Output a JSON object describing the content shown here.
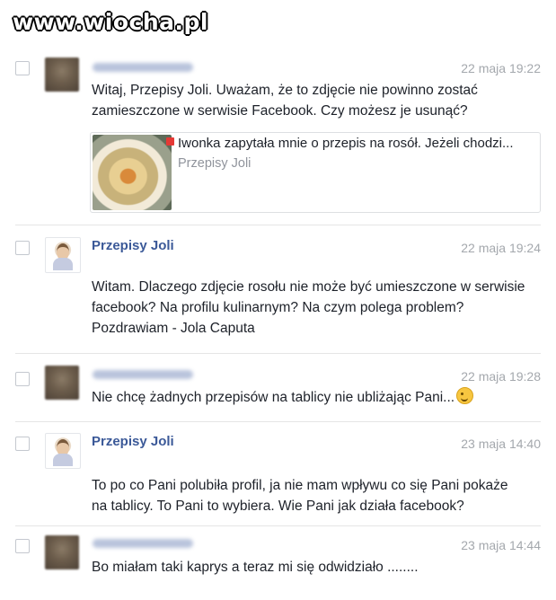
{
  "watermark": "www.wiocha.pl",
  "messages": [
    {
      "sender": "",
      "time": "22 maja 19:22",
      "lines": [
        "Witaj, Przepisy Joli. Uważam, że to zdjęcie nie powinno zostać",
        "zamieszczone w serwisie Facebook. Czy możesz je usunąć?"
      ],
      "attachment": {
        "title": "Iwonka zapytała mnie o przepis na rosół. Jeżeli chodzi...",
        "source": "Przepisy Joli"
      }
    },
    {
      "sender": "Przepisy Joli",
      "time": "22 maja 19:24",
      "lines": [
        "Witam. Dlaczego zdjęcie rosołu nie może być umieszczone w serwisie",
        "facebook? Na profilu kulinarnym? Na czym polega problem?",
        "Pozdrawiam - Jola Caputa"
      ]
    },
    {
      "sender": "",
      "time": "22 maja 19:28",
      "lines": [
        "Nie chcę żadnych przepisów na tablicy nie ubliżając Pani..."
      ],
      "emoji": "wink-emoji"
    },
    {
      "sender": "Przepisy Joli",
      "time": "23 maja 14:40",
      "lines": [
        "To po co Pani polubiła profil, ja nie mam wpływu co się Pani pokaże",
        "na tablicy. To Pani to wybiera. Wie Pani jak działa facebook?"
      ]
    },
    {
      "sender": "",
      "time": "23 maja 14:44",
      "lines": [
        "Bo miałam taki kaprys a teraz mi się odwidziało ........"
      ]
    }
  ]
}
